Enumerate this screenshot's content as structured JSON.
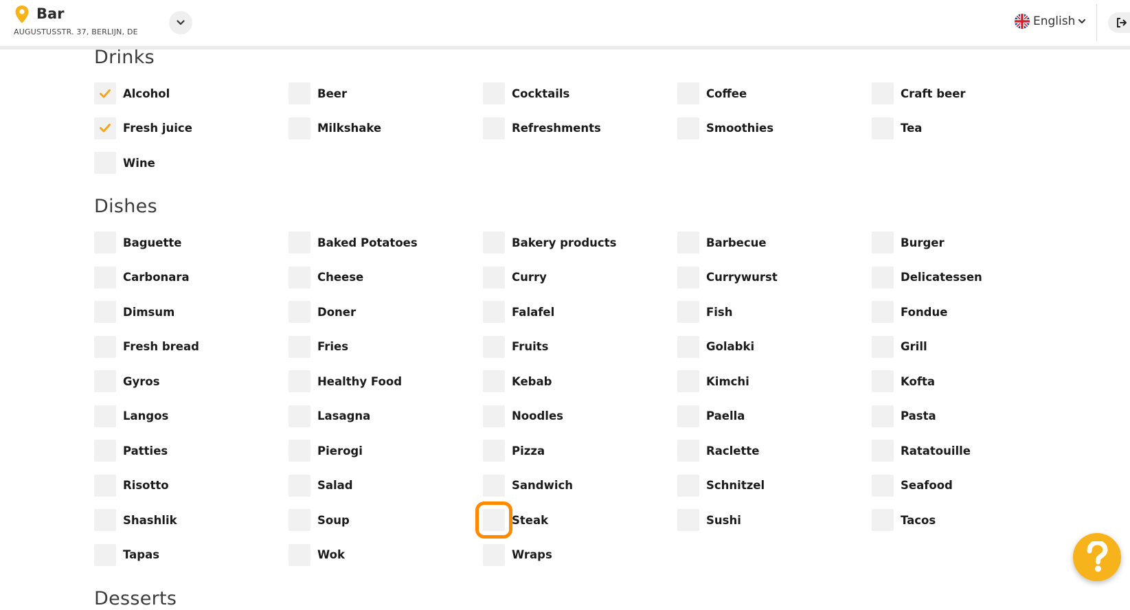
{
  "header": {
    "venue_name": "Bar",
    "venue_address": "AUGUSTUSSTR. 37, BERLIJN, DE",
    "language": "English",
    "brand_color": "#f7b31b",
    "accent_color": "#ff8a00"
  },
  "sections": {
    "drinks": {
      "title": "Drinks",
      "items": [
        {
          "label": "Alcohol",
          "checked": true
        },
        {
          "label": "Beer",
          "checked": false
        },
        {
          "label": "Cocktails",
          "checked": false
        },
        {
          "label": "Coffee",
          "checked": false
        },
        {
          "label": "Craft beer",
          "checked": false
        },
        {
          "label": "Fresh juice",
          "checked": true
        },
        {
          "label": "Milkshake",
          "checked": false
        },
        {
          "label": "Refreshments",
          "checked": false
        },
        {
          "label": "Smoothies",
          "checked": false
        },
        {
          "label": "Tea",
          "checked": false
        },
        {
          "label": "Wine",
          "checked": false
        }
      ]
    },
    "dishes": {
      "title": "Dishes",
      "items": [
        {
          "label": "Baguette",
          "checked": false
        },
        {
          "label": "Baked Potatoes",
          "checked": false
        },
        {
          "label": "Bakery products",
          "checked": false
        },
        {
          "label": "Barbecue",
          "checked": false
        },
        {
          "label": "Burger",
          "checked": false
        },
        {
          "label": "Carbonara",
          "checked": false
        },
        {
          "label": "Cheese",
          "checked": false
        },
        {
          "label": "Curry",
          "checked": false
        },
        {
          "label": "Currywurst",
          "checked": false
        },
        {
          "label": "Delicatessen",
          "checked": false
        },
        {
          "label": "Dimsum",
          "checked": false
        },
        {
          "label": "Doner",
          "checked": false
        },
        {
          "label": "Falafel",
          "checked": false
        },
        {
          "label": "Fish",
          "checked": false
        },
        {
          "label": "Fondue",
          "checked": false
        },
        {
          "label": "Fresh bread",
          "checked": false
        },
        {
          "label": "Fries",
          "checked": false
        },
        {
          "label": "Fruits",
          "checked": false
        },
        {
          "label": "Golabki",
          "checked": false
        },
        {
          "label": "Grill",
          "checked": false
        },
        {
          "label": "Gyros",
          "checked": false
        },
        {
          "label": "Healthy Food",
          "checked": false
        },
        {
          "label": "Kebab",
          "checked": false
        },
        {
          "label": "Kimchi",
          "checked": false
        },
        {
          "label": "Kofta",
          "checked": false
        },
        {
          "label": "Langos",
          "checked": false
        },
        {
          "label": "Lasagna",
          "checked": false
        },
        {
          "label": "Noodles",
          "checked": false
        },
        {
          "label": "Paella",
          "checked": false
        },
        {
          "label": "Pasta",
          "checked": false
        },
        {
          "label": "Patties",
          "checked": false
        },
        {
          "label": "Pierogi",
          "checked": false
        },
        {
          "label": "Pizza",
          "checked": false
        },
        {
          "label": "Raclette",
          "checked": false
        },
        {
          "label": "Ratatouille",
          "checked": false
        },
        {
          "label": "Risotto",
          "checked": false
        },
        {
          "label": "Salad",
          "checked": false
        },
        {
          "label": "Sandwich",
          "checked": false
        },
        {
          "label": "Schnitzel",
          "checked": false
        },
        {
          "label": "Seafood",
          "checked": false
        },
        {
          "label": "Shashlik",
          "checked": false
        },
        {
          "label": "Soup",
          "checked": false
        },
        {
          "label": "Steak",
          "checked": false,
          "highlighted": true
        },
        {
          "label": "Sushi",
          "checked": false
        },
        {
          "label": "Tacos",
          "checked": false
        },
        {
          "label": "Tapas",
          "checked": false
        },
        {
          "label": "Wok",
          "checked": false
        },
        {
          "label": "Wraps",
          "checked": false
        }
      ]
    },
    "desserts": {
      "title": "Desserts"
    }
  },
  "help": {
    "icon": "question-icon"
  }
}
